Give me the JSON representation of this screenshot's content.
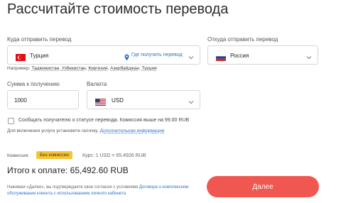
{
  "page": {
    "title": "Рассчитайте стоимость перевода"
  },
  "destination": {
    "label": "Куда отправить перевод",
    "country": "Турция",
    "locate_link": "Где получить перевод",
    "flag_icon": "turkey-flag-icon",
    "examples_prefix": "Например:",
    "examples": [
      "Таджикистан",
      "Узбекистан",
      "Киргизия",
      "Азербайджан",
      "Турция"
    ]
  },
  "origin": {
    "label": "Откуда отправить перевод",
    "country": "Россия",
    "flag_icon": "russia-flag-icon"
  },
  "amount": {
    "label": "Сумма к получению",
    "value": "1000"
  },
  "currency": {
    "label": "Валюта",
    "value": "USD",
    "flag_icon": "usa-flag-icon"
  },
  "notify": {
    "label": "Сообщать получателю о статусе перевода. Комиссия выше на 99.00 RUB",
    "checked": false,
    "hint": "Для включения услуги установите галочку.",
    "more_link": "Дополнительная информация"
  },
  "commission": {
    "label": "Комиссия:",
    "badge": "Без комиссии",
    "rate": "Курс: 1 USD = 65.4926 RUB"
  },
  "total": {
    "text": "Итого к оплате: 65,492.60 RUB"
  },
  "terms": {
    "prefix": "Нажимая «Далее», вы подтверждаете свое согласие с условиями",
    "link": "Договора о комплексном обслуживании клиента с использованием личного кабинета"
  },
  "next_button": {
    "label": "Далее"
  },
  "colors": {
    "accent": "#f15751",
    "link": "#2f73c9",
    "badge": "#f7c531"
  }
}
